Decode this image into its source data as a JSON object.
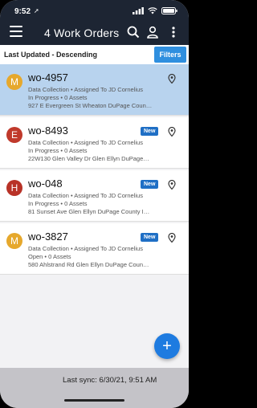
{
  "status_bar": {
    "time": "9:52",
    "location_arrow": "➚"
  },
  "header": {
    "title": "4 Work Orders"
  },
  "sort": {
    "label": "Last Updated - Descending",
    "filters_label": "Filters"
  },
  "work_orders": [
    {
      "initial": "M",
      "avatar_color": "#e6a82c",
      "id": "wo-4957",
      "line1": "Data Collection • Assigned To JD Cornelius",
      "line2": "In Progress • 0 Assets",
      "line3": "927 E Evergreen St Wheaton DuPage Coun…",
      "badge": "",
      "selected": true
    },
    {
      "initial": "E",
      "avatar_color": "#c0392b",
      "id": "wo-8493",
      "line1": "Data Collection • Assigned To JD Cornelius",
      "line2": "In Progress • 0 Assets",
      "line3": "22W130 Glen Valley Dr Glen Ellyn DuPage…",
      "badge": "New",
      "selected": false
    },
    {
      "initial": "H",
      "avatar_color": "#b83227",
      "id": "wo-048",
      "line1": "Data Collection • Assigned To JD Cornelius",
      "line2": "In Progress • 0 Assets",
      "line3": "81 Sunset Ave Glen Ellyn DuPage County I…",
      "badge": "New",
      "selected": false
    },
    {
      "initial": "M",
      "avatar_color": "#e6a82c",
      "id": "wo-3827",
      "line1": "Data Collection • Assigned To JD Cornelius",
      "line2": "Open • 0 Assets",
      "line3": "580 Ahlstrand Rd Glen Ellyn DuPage Coun…",
      "badge": "New",
      "selected": false
    }
  ],
  "fab": {
    "label": "+"
  },
  "footer": {
    "sync_text": "Last sync: 6/30/21, 9:51 AM"
  }
}
